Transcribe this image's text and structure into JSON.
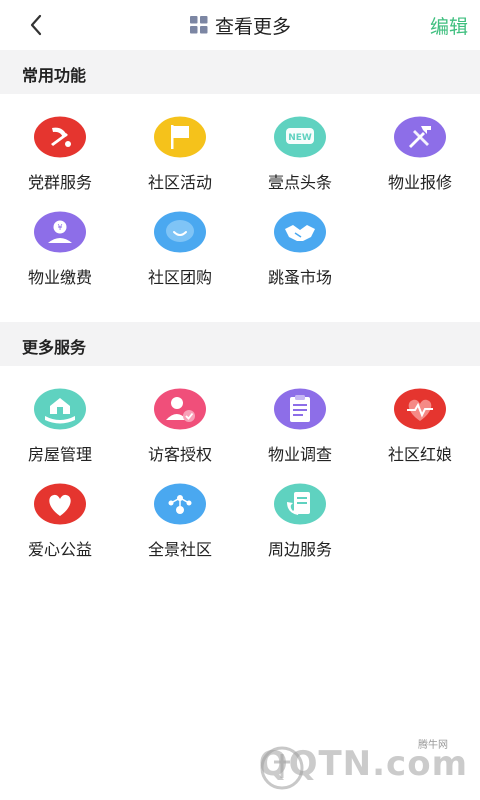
{
  "header": {
    "title": "查看更多",
    "edit_label": "编辑"
  },
  "sections": [
    {
      "title": "常用功能",
      "items": [
        {
          "label": "党群服务",
          "icon": "party-emblem-icon",
          "color": "#e5352f"
        },
        {
          "label": "社区活动",
          "icon": "flag-icon",
          "color": "#f5c21b"
        },
        {
          "label": "壹点头条",
          "icon": "news-icon",
          "color": "#5fd2c0"
        },
        {
          "label": "物业报修",
          "icon": "repair-tools-icon",
          "color": "#8d6ee8"
        },
        {
          "label": "物业缴费",
          "icon": "payment-icon",
          "color": "#8d6ee8"
        },
        {
          "label": "社区团购",
          "icon": "chat-bubble-icon",
          "color": "#4aa8f0"
        },
        {
          "label": "跳蚤市场",
          "icon": "handshake-icon",
          "color": "#4aa8f0"
        }
      ]
    },
    {
      "title": "更多服务",
      "items": [
        {
          "label": "房屋管理",
          "icon": "house-hand-icon",
          "color": "#5fd2c0"
        },
        {
          "label": "访客授权",
          "icon": "visitor-check-icon",
          "color": "#f04f7a"
        },
        {
          "label": "物业调查",
          "icon": "clipboard-icon",
          "color": "#8d6ee8"
        },
        {
          "label": "社区红娘",
          "icon": "heartbeat-icon",
          "color": "#e5352f"
        },
        {
          "label": "爱心公益",
          "icon": "heart-icon",
          "color": "#e5352f"
        },
        {
          "label": "全景社区",
          "icon": "panorama-icon",
          "color": "#4aa8f0"
        },
        {
          "label": "周边服务",
          "icon": "phone-service-icon",
          "color": "#5fd2c0"
        }
      ]
    }
  ],
  "watermark": {
    "text": "腾牛网",
    "logo": "QQTN.com"
  }
}
